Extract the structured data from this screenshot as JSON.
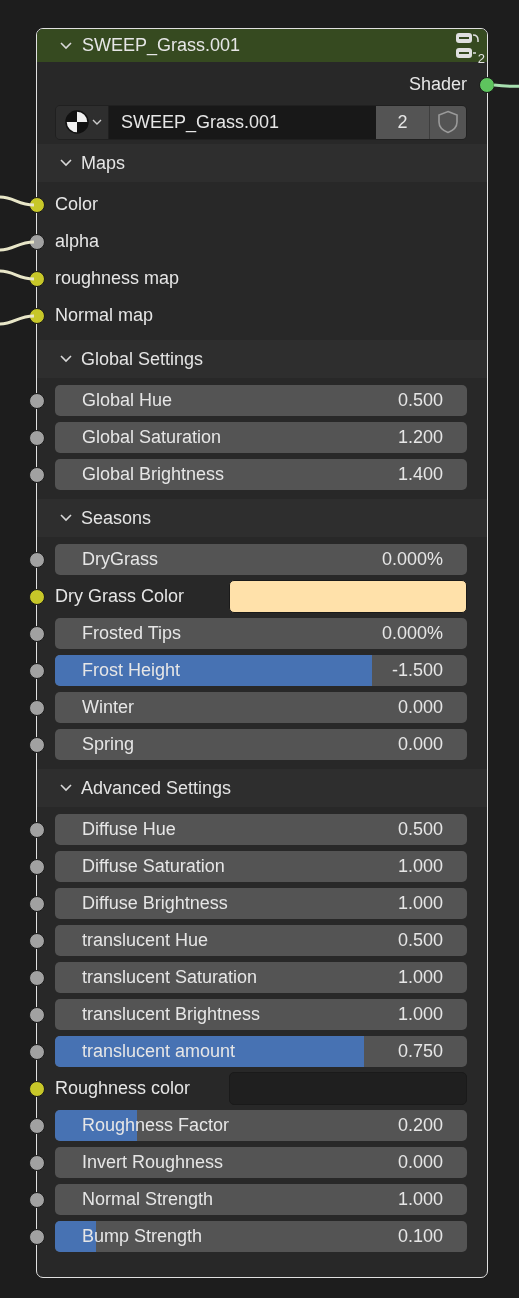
{
  "node": {
    "title": "SWEEP_Grass.001",
    "expanded": true,
    "user_count": "2"
  },
  "output": {
    "label": "Shader",
    "linked": true
  },
  "material": {
    "name": "SWEEP_Grass.001",
    "users": "2"
  },
  "panels": [
    {
      "title": "Maps",
      "expanded": true,
      "items": [
        {
          "kind": "input",
          "label": "Color",
          "socket": {
            "color": "#c7c729"
          },
          "linked": true
        },
        {
          "kind": "input",
          "label": "alpha",
          "socket": {
            "color": "#a1a1a1"
          },
          "linked": true
        },
        {
          "kind": "input",
          "label": "roughness map",
          "socket": {
            "color": "#c7c729"
          },
          "linked": true
        },
        {
          "kind": "input",
          "label": "Normal map",
          "socket": {
            "color": "#c7c729"
          },
          "linked": true
        }
      ]
    },
    {
      "title": "Global Settings",
      "expanded": true,
      "items": [
        {
          "kind": "number",
          "label": "Global Hue",
          "value": "0.500",
          "socket": {
            "color": "#a1a1a1"
          }
        },
        {
          "kind": "number",
          "label": "Global Saturation",
          "value": "1.200",
          "socket": {
            "color": "#a1a1a1"
          }
        },
        {
          "kind": "number",
          "label": "Global Brightness",
          "value": "1.400",
          "socket": {
            "color": "#a1a1a1"
          }
        }
      ]
    },
    {
      "title": "Seasons",
      "expanded": true,
      "items": [
        {
          "kind": "number",
          "label": "DryGrass",
          "value": "0.000%",
          "socket": {
            "color": "#a1a1a1"
          }
        },
        {
          "kind": "swatch",
          "label": "Dry Grass Color",
          "color": "#ffe1aa",
          "socket": {
            "color": "#c7c729"
          }
        },
        {
          "kind": "number",
          "label": "Frosted Tips",
          "value": "0.000%",
          "socket": {
            "color": "#a1a1a1"
          }
        },
        {
          "kind": "slider",
          "label": "Frost Height",
          "value": "-1.500",
          "level": 0.77,
          "socket": {
            "color": "#a1a1a1"
          }
        },
        {
          "kind": "number",
          "label": "Winter",
          "value": "0.000",
          "socket": {
            "color": "#a1a1a1"
          }
        },
        {
          "kind": "number",
          "label": "Spring",
          "value": "0.000",
          "socket": {
            "color": "#a1a1a1"
          }
        }
      ]
    },
    {
      "title": "Advanced Settings",
      "expanded": true,
      "items": [
        {
          "kind": "number",
          "label": "Diffuse Hue",
          "value": "0.500",
          "socket": {
            "color": "#a1a1a1"
          }
        },
        {
          "kind": "number",
          "label": "Diffuse Saturation",
          "value": "1.000",
          "socket": {
            "color": "#a1a1a1"
          }
        },
        {
          "kind": "number",
          "label": "Diffuse Brightness",
          "value": "1.000",
          "socket": {
            "color": "#a1a1a1"
          }
        },
        {
          "kind": "number",
          "label": "translucent Hue",
          "value": "0.500",
          "socket": {
            "color": "#a1a1a1"
          }
        },
        {
          "kind": "number",
          "label": "translucent Saturation",
          "value": "1.000",
          "socket": {
            "color": "#a1a1a1"
          }
        },
        {
          "kind": "number",
          "label": "translucent Brightness",
          "value": "1.000",
          "socket": {
            "color": "#a1a1a1"
          }
        },
        {
          "kind": "slider",
          "label": "translucent amount",
          "value": "0.750",
          "level": 0.75,
          "socket": {
            "color": "#a1a1a1"
          }
        },
        {
          "kind": "swatch",
          "label": "Roughness color",
          "color": "#1f1f1f",
          "socket": {
            "color": "#c7c729"
          }
        },
        {
          "kind": "slider",
          "label": "Roughness Factor",
          "value": "0.200",
          "level": 0.2,
          "socket": {
            "color": "#a1a1a1"
          }
        },
        {
          "kind": "number",
          "label": "Invert Roughness",
          "value": "0.000",
          "socket": {
            "color": "#a1a1a1"
          }
        },
        {
          "kind": "number",
          "label": "Normal Strength",
          "value": "1.000",
          "socket": {
            "color": "#a1a1a1"
          }
        },
        {
          "kind": "slider",
          "label": "Bump Strength",
          "value": "0.100",
          "level": 0.1,
          "socket": {
            "color": "#a1a1a1"
          }
        }
      ]
    }
  ]
}
